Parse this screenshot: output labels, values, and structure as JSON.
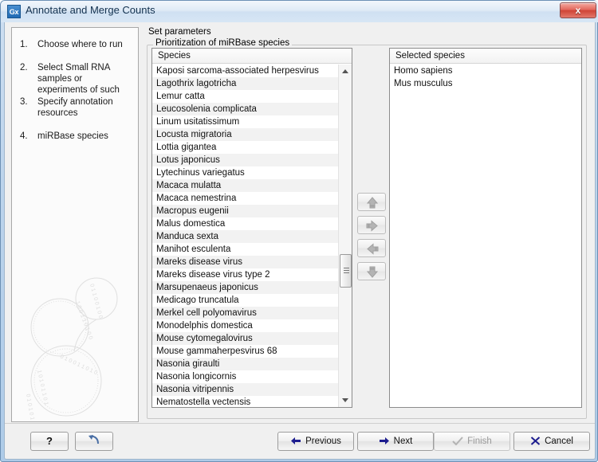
{
  "window": {
    "title": "Annotate and Merge Counts",
    "icon_label": "Gx",
    "close_label": "x"
  },
  "sidebar": {
    "steps": [
      {
        "num": "1.",
        "label": "Choose where to run"
      },
      {
        "num": "2.",
        "label": "Select Small RNA samples or experiments of such"
      },
      {
        "num": "3.",
        "label": "Specify annotation resources"
      },
      {
        "num": "4.",
        "label": "miRBase species"
      }
    ]
  },
  "content": {
    "section_title": "Set parameters",
    "group_label": "Prioritization of miRBase species"
  },
  "species_list": {
    "header": "Species",
    "items": [
      "Kaposi sarcoma-associated herpesvirus",
      "Lagothrix lagotricha",
      "Lemur catta",
      "Leucosolenia complicata",
      "Linum usitatissimum",
      "Locusta migratoria",
      "Lottia gigantea",
      "Lotus japonicus",
      "Lytechinus variegatus",
      "Macaca mulatta",
      "Macaca nemestrina",
      "Macropus eugenii",
      "Malus domestica",
      "Manduca sexta",
      "Manihot esculenta",
      "Mareks disease virus",
      "Mareks disease virus type 2",
      "Marsupenaeus japonicus",
      "Medicago truncatula",
      "Merkel cell polyomavirus",
      "Monodelphis domestica",
      "Mouse cytomegalovirus",
      "Mouse gammaherpesvirus 68",
      "Nasonia giraulti",
      "Nasonia longicornis",
      "Nasonia vitripennis",
      "Nematostella vectensis"
    ]
  },
  "selected_list": {
    "header": "Selected species",
    "items": [
      "Homo sapiens",
      "Mus musculus"
    ]
  },
  "transfer_buttons": [
    {
      "name": "move-up",
      "icon": "arrow-up-icon"
    },
    {
      "name": "add",
      "icon": "arrow-right-icon"
    },
    {
      "name": "remove",
      "icon": "arrow-left-icon"
    },
    {
      "name": "move-down",
      "icon": "arrow-down-icon"
    }
  ],
  "footer": {
    "help_label": "?",
    "reset_label": "",
    "previous_label": "Previous",
    "next_label": "Next",
    "finish_label": "Finish",
    "cancel_label": "Cancel"
  },
  "colors": {
    "accent": "#1f6ab4",
    "close": "#cf4436",
    "nav_icon": "#1d1d8f",
    "disabled_text": "#9a9a9a",
    "row_alt": "#f2f2f2"
  }
}
